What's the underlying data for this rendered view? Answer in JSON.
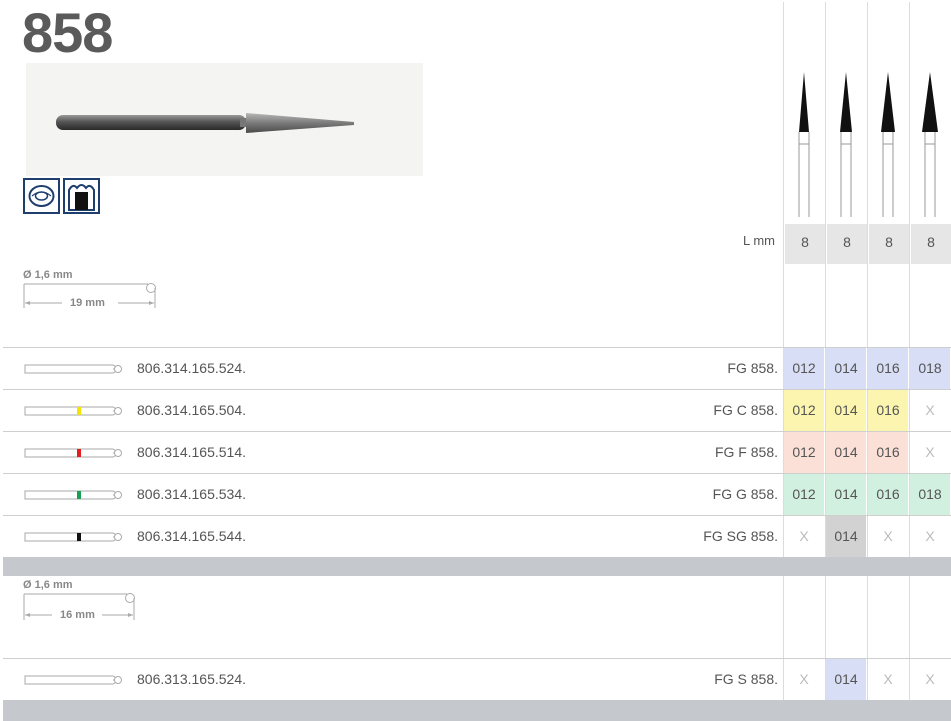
{
  "product": {
    "title": "858"
  },
  "header": {
    "l_mm_label": "L mm",
    "lengths": [
      "8",
      "8",
      "8",
      "8"
    ]
  },
  "shank1": {
    "diameter": "Ø 1,6 mm",
    "length": "19 mm"
  },
  "shank2": {
    "diameter": "Ø 1,6 mm",
    "length": "16 mm"
  },
  "colors": {
    "blue": "#d7def5",
    "yellow": "#fbf5b0",
    "red": "#fae0d6",
    "green": "#d2f0e0",
    "gray": "#d2d2d2",
    "band_yellow": "#f2e600",
    "band_red": "#e02020",
    "band_green": "#1aa050",
    "band_black": "#111111"
  },
  "rows": [
    {
      "code": "806.314.165.524.",
      "label": "FG 858.",
      "band": "none",
      "cells": [
        "012",
        "014",
        "016",
        "018"
      ],
      "fills": [
        "blue",
        "blue",
        "blue",
        "blue"
      ]
    },
    {
      "code": "806.314.165.504.",
      "label": "FG C 858.",
      "band": "yellow",
      "cells": [
        "012",
        "014",
        "016",
        "X"
      ],
      "fills": [
        "yellow",
        "yellow",
        "yellow",
        "none"
      ]
    },
    {
      "code": "806.314.165.514.",
      "label": "FG F 858.",
      "band": "red",
      "cells": [
        "012",
        "014",
        "016",
        "X"
      ],
      "fills": [
        "red",
        "red",
        "red",
        "none"
      ]
    },
    {
      "code": "806.314.165.534.",
      "label": "FG G 858.",
      "band": "green",
      "cells": [
        "012",
        "014",
        "016",
        "018"
      ],
      "fills": [
        "green",
        "green",
        "green",
        "green"
      ]
    },
    {
      "code": "806.314.165.544.",
      "label": "FG SG 858.",
      "band": "black",
      "cells": [
        "X",
        "014",
        "X",
        "X"
      ],
      "fills": [
        "none",
        "gray",
        "none",
        "none"
      ]
    },
    {
      "code": "806.313.165.524.",
      "label": "FG S 858.",
      "band": "none",
      "cells": [
        "X",
        "014",
        "X",
        "X"
      ],
      "fills": [
        "none",
        "blue",
        "none",
        "none"
      ]
    }
  ]
}
